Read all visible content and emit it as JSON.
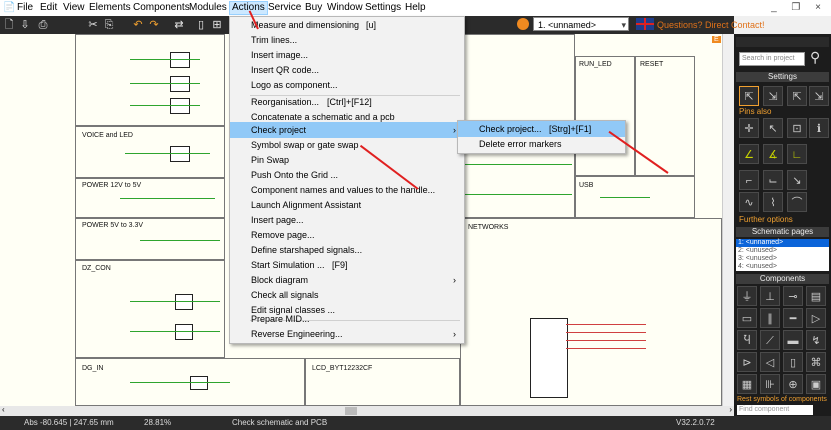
{
  "menubar": {
    "items": [
      "File",
      "Edit",
      "View",
      "Elements",
      "Components",
      "Modules",
      "Actions",
      "Service",
      "Buy",
      "Window",
      "Settings",
      "Help"
    ],
    "active": "Actions",
    "window_controls": "_ ❐ ×"
  },
  "toolbar": {
    "project_select": "1. <unnamed>",
    "contact_link": "Questions? Direct Contact!"
  },
  "canvas": {
    "labels": {
      "voice_and_led": "VOICE and LED",
      "power_12v": "POWER 12V to 5V",
      "power_5v": "POWER 5V to 3.3V",
      "dz_con": "DZ_CON",
      "dg_in": "DG_IN",
      "lcd": "LCD_BYT12232CF",
      "networks": "NETWORKS",
      "run_led": "RUN_LED",
      "reset": "RESET",
      "usb": "USB",
      "e_marker": "E"
    }
  },
  "actions_menu": {
    "items": [
      {
        "label": "Measure and dimensioning",
        "shortcut": "[u]"
      },
      {
        "label": "Trim lines...",
        "shortcut": ""
      },
      {
        "label": "Insert image...",
        "shortcut": ""
      },
      {
        "label": "Insert QR code...",
        "shortcut": ""
      },
      {
        "label": "Logo as component...",
        "shortcut": ""
      },
      {
        "label": "Reorganisation...",
        "shortcut": "[Ctrl]+[F12]"
      },
      {
        "label": "Concatenate a schematic and a pcb",
        "shortcut": ""
      },
      {
        "label": "Check project",
        "shortcut": "",
        "submenu": true
      },
      {
        "label": "Symbol swap or gate swap",
        "shortcut": ""
      },
      {
        "label": "Pin Swap",
        "shortcut": ""
      },
      {
        "label": "Push Onto the Grid ...",
        "shortcut": ""
      },
      {
        "label": "Component names and values to the handle...",
        "shortcut": ""
      },
      {
        "label": "Launch Alignment Assistant",
        "shortcut": ""
      },
      {
        "label": "Insert page...",
        "shortcut": ""
      },
      {
        "label": "Remove page...",
        "shortcut": ""
      },
      {
        "label": "Define starshaped signals...",
        "shortcut": ""
      },
      {
        "label": "Start Simulation ...",
        "shortcut": "[F9]"
      },
      {
        "label": "Block diagram",
        "shortcut": "",
        "submenu": true
      },
      {
        "label": "Check all signals",
        "shortcut": ""
      },
      {
        "label": "Edit signal classes ...",
        "shortcut": ""
      },
      {
        "label": "Prepare MID...",
        "shortcut": ""
      },
      {
        "label": "Reverse Engineering...",
        "shortcut": "",
        "submenu": true
      }
    ]
  },
  "check_submenu": {
    "items": [
      {
        "label": "Check project...",
        "shortcut": "[Strg]+[F1]"
      },
      {
        "label": "Delete error markers",
        "shortcut": ""
      }
    ]
  },
  "panel": {
    "search_placeholder": "Search in project",
    "settings_title": "Settings",
    "pins_also": "Pins also",
    "further_options": "Further options",
    "schematic_pages_title": "Schematic pages",
    "pages": [
      "1: <unnamed>",
      "2: <unused>",
      "3: <unused>",
      "4: <unused>"
    ],
    "components_title": "Components",
    "rest_symbols": "Rest symbols of components",
    "find_component_placeholder": "Find component"
  },
  "statusbar": {
    "coords": "Abs -80.645 | 247.65 mm",
    "zoom": "28.81%",
    "message": "Check schematic and PCB",
    "version": "V32.2.0.72"
  },
  "colors": {
    "accent": "#f0a030",
    "highlight": "#91c9f7",
    "wire": "#2ea52e",
    "arrow": "#e02020"
  }
}
